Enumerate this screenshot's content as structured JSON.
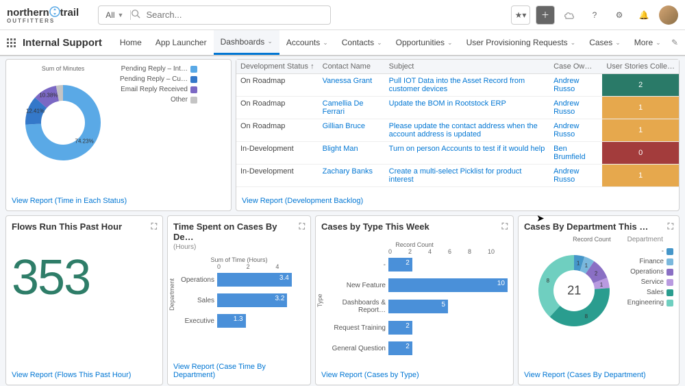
{
  "logo": {
    "line1": "northern",
    "line2": "trail",
    "sub": "OUTFITTERS"
  },
  "search": {
    "all": "All",
    "placeholder": "Search..."
  },
  "nav": {
    "app": "Internal Support",
    "items": [
      "Home",
      "App Launcher",
      "Dashboards",
      "Accounts",
      "Contacts",
      "Opportunities",
      "User Provisioning Requests",
      "Cases",
      "More"
    ],
    "active": 2
  },
  "donut1": {
    "title": "Sum of Minutes",
    "segments": [
      {
        "label": "Pending Reply – Int…",
        "pct": 74.23,
        "color": "#5aa9e6"
      },
      {
        "label": "Pending Reply – Cu…",
        "pct": 12.41,
        "color": "#3478c9"
      },
      {
        "label": "Email Reply Received",
        "pct": 10.38,
        "color": "#7b68c4"
      },
      {
        "label": "Other",
        "pct": 2.98,
        "color": "#c4c4c4"
      }
    ],
    "viewlink": "View Report (Time in Each Status)"
  },
  "table": {
    "cols": [
      "Development Status ↑",
      "Contact Name",
      "Subject",
      "Case Ow…",
      "User Stories Colle…"
    ],
    "rows": [
      {
        "status": "On Roadmap",
        "contact": "Vanessa Grant",
        "subject": "Pull IOT Data into the Asset Record from customer devices",
        "owner": "Andrew Russo",
        "count": 2,
        "color": "#2a7a68"
      },
      {
        "status": "On Roadmap",
        "contact": "Camellia De Ferrari",
        "subject": "Update the BOM in Rootstock ERP",
        "owner": "Andrew Russo",
        "count": 1,
        "color": "#e6a84d"
      },
      {
        "status": "On Roadmap",
        "contact": "Gillian Bruce",
        "subject": "Please update the contact address when the account address is updated",
        "owner": "Andrew Russo",
        "count": 1,
        "color": "#e6a84d"
      },
      {
        "status": "In-Development",
        "contact": "Blight Man",
        "subject": "Turn on person Accounts to test if it would help",
        "owner": "Ben Brumfield",
        "count": 0,
        "color": "#a33c3c"
      },
      {
        "status": "In-Development",
        "contact": "Zachary Banks",
        "subject": "Create a multi-select Picklist for product interest",
        "owner": "Andrew Russo",
        "count": 1,
        "color": "#e6a84d"
      }
    ],
    "viewlink": "View Report (Development Backlog)"
  },
  "flows": {
    "title": "Flows Run This Past Hour",
    "value": "353",
    "viewlink": "View Report (Flows This Past Hour)"
  },
  "timecard": {
    "title": "Time Spent on Cases By De…",
    "sub": "(Hours)",
    "axis": "Sum of Time (Hours)",
    "yaxis": "Department",
    "ticks": [
      "0",
      "2",
      "4"
    ],
    "max": 4,
    "bars": [
      {
        "label": "Operations",
        "val": 3.4
      },
      {
        "label": "Sales",
        "val": 3.2
      },
      {
        "label": "Executive",
        "val": 1.3
      }
    ],
    "viewlink": "View Report (Case Time By Department)"
  },
  "casestype": {
    "title": "Cases by Type This Week",
    "axis": "Record Count",
    "yaxis": "Type",
    "ticks": [
      "0",
      "2",
      "4",
      "6",
      "8",
      "10"
    ],
    "max": 10,
    "bars": [
      {
        "label": "-",
        "val": 2
      },
      {
        "label": "New Feature",
        "val": 10
      },
      {
        "label": "Dashboards & Report…",
        "val": 5
      },
      {
        "label": "Request Training",
        "val": 2
      },
      {
        "label": "General Question",
        "val": 2
      }
    ],
    "viewlink": "View Report (Cases by Type)"
  },
  "casesdept": {
    "title": "Cases By Department This …",
    "legendtitle": "Department",
    "centerlabel": "Record Count",
    "center": 21,
    "segs": [
      {
        "label": "-",
        "val": 1,
        "color": "#4596c9"
      },
      {
        "label": "Finance",
        "val": 1,
        "color": "#7ab8dd"
      },
      {
        "label": "Operations",
        "val": 2,
        "color": "#8a6fc4"
      },
      {
        "label": "Service",
        "val": 1,
        "color": "#b99ae0"
      },
      {
        "label": "Sales",
        "val": 8,
        "color": "#2a9d8f"
      },
      {
        "label": "Engineering",
        "val": 8,
        "color": "#6fcfc0"
      }
    ],
    "viewlink": "View Report (Cases By Department)"
  },
  "chart_data": [
    {
      "type": "pie",
      "title": "Sum of Minutes",
      "series": [
        {
          "name": "Pending Reply – Internal",
          "value": 74.23
        },
        {
          "name": "Pending Reply – Customer",
          "value": 12.41
        },
        {
          "name": "Email Reply Received",
          "value": 10.38
        },
        {
          "name": "Other",
          "value": 2.98
        }
      ]
    },
    {
      "type": "bar",
      "title": "Time Spent on Cases By Department (Hours)",
      "xlabel": "Sum of Time (Hours)",
      "ylabel": "Department",
      "categories": [
        "Operations",
        "Sales",
        "Executive"
      ],
      "values": [
        3.4,
        3.2,
        1.3
      ],
      "xlim": [
        0,
        4
      ]
    },
    {
      "type": "bar",
      "title": "Cases by Type This Week",
      "xlabel": "Record Count",
      "ylabel": "Type",
      "categories": [
        "-",
        "New Feature",
        "Dashboards & Reports",
        "Request Training",
        "General Question"
      ],
      "values": [
        2,
        10,
        5,
        2,
        2
      ],
      "xlim": [
        0,
        10
      ]
    },
    {
      "type": "pie",
      "title": "Cases By Department This Week",
      "series": [
        {
          "name": "-",
          "value": 1
        },
        {
          "name": "Finance",
          "value": 1
        },
        {
          "name": "Operations",
          "value": 2
        },
        {
          "name": "Service",
          "value": 1
        },
        {
          "name": "Sales",
          "value": 8
        },
        {
          "name": "Engineering",
          "value": 8
        }
      ],
      "total": 21
    }
  ]
}
